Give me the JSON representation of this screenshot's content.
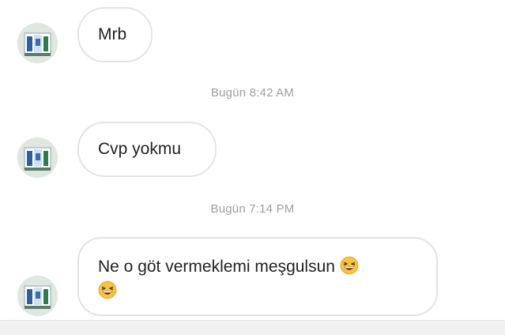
{
  "conversation": {
    "messages": [
      {
        "text": "Mrb"
      },
      {
        "text": "Cvp yokmu"
      },
      {
        "text": "Ne o göt vermeklemi meşgulsun",
        "emoji": "laughing-emoji"
      }
    ],
    "timestamps": [
      "Bugün 8:42 AM",
      "Bugün 7:14 PM"
    ]
  },
  "icons": {
    "avatar": "user-avatar",
    "emoji": "grinning-squinting-face-emoji"
  },
  "colors": {
    "bubble_border": "#e3e3e3",
    "timestamp_text": "#9e9e9e",
    "message_text": "#222222",
    "emoji_face": "#f6c343"
  }
}
